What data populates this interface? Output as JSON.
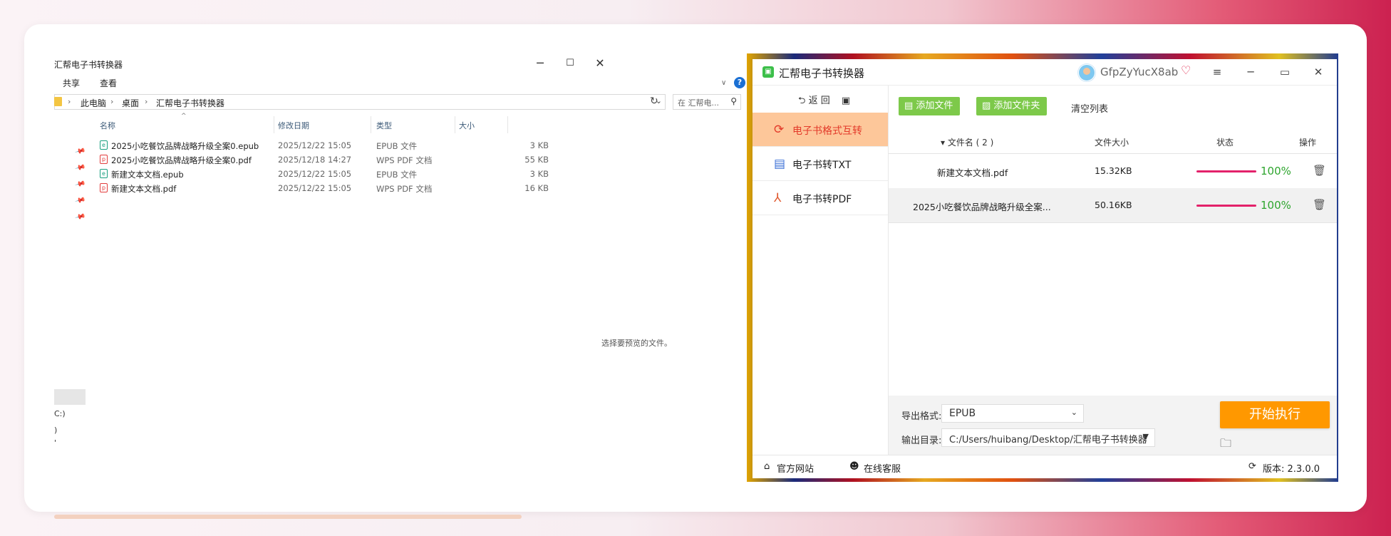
{
  "explorer": {
    "title": "汇帮电子书转换器",
    "menu": [
      "共享",
      "查看"
    ],
    "help": "?",
    "breadcrumb": [
      "此电脑",
      "桌面",
      "汇帮电子书转换器"
    ],
    "search_placeholder": "在 汇帮电...",
    "columns": [
      "名称",
      "修改日期",
      "类型",
      "大小"
    ],
    "files": [
      {
        "name": "2025小吃餐饮品牌战略升级全案0.epub",
        "date": "2025/12/22 15:05",
        "type": "EPUB 文件",
        "size": "3 KB",
        "kind": "epub"
      },
      {
        "name": "2025小吃餐饮品牌战略升级全案0.pdf",
        "date": "2025/12/18 14:27",
        "type": "WPS PDF 文档",
        "size": "55 KB",
        "kind": "pdf"
      },
      {
        "name": "新建文本文档.epub",
        "date": "2025/12/22 15:05",
        "type": "EPUB 文件",
        "size": "3 KB",
        "kind": "epub"
      },
      {
        "name": "新建文本文档.pdf",
        "date": "2025/12/22 15:05",
        "type": "WPS PDF 文档",
        "size": "16 KB",
        "kind": "pdf"
      }
    ],
    "preview_text": "选择要预览的文件。",
    "side_fragments": [
      "C:)",
      ")",
      "'"
    ]
  },
  "converter": {
    "title": "汇帮电子书转换器",
    "username": "GfpZyYucX8ab",
    "back_label": "返 回",
    "nav": [
      {
        "label": "电子书格式互转",
        "icon": "refresh-icon",
        "active": true
      },
      {
        "label": "电子书转TXT",
        "icon": "txt-icon",
        "active": false
      },
      {
        "label": "电子书转PDF",
        "icon": "pdf-icon",
        "active": false
      }
    ],
    "add_file": "添加文件",
    "add_folder": "添加文件夹",
    "clear_list": "清空列表",
    "table_headers": {
      "name": "▾ 文件名 ( 2 )",
      "size": "文件大小",
      "status": "状态",
      "action": "操作"
    },
    "rows": [
      {
        "name": "新建文本文档.pdf",
        "size": "15.32KB",
        "progress": 100,
        "progress_text": "100%"
      },
      {
        "name": "2025小吃餐饮品牌战略升级全案...",
        "size": "50.16KB",
        "progress": 100,
        "progress_text": "100%"
      }
    ],
    "export_format_label": "导出格式:",
    "export_format": "EPUB",
    "output_dir_label": "输出目录:",
    "output_dir": "C:/Users/huibang/Desktop/汇帮电子书转换器",
    "start_button": "开始执行",
    "footer": {
      "website": "官方网站",
      "support": "在线客服",
      "version": "版本: 2.3.0.0"
    },
    "colors": {
      "accent": "#ff9800",
      "green": "#7dc94a",
      "active_nav": "#fdc79a",
      "progress": "#e3216a"
    }
  }
}
